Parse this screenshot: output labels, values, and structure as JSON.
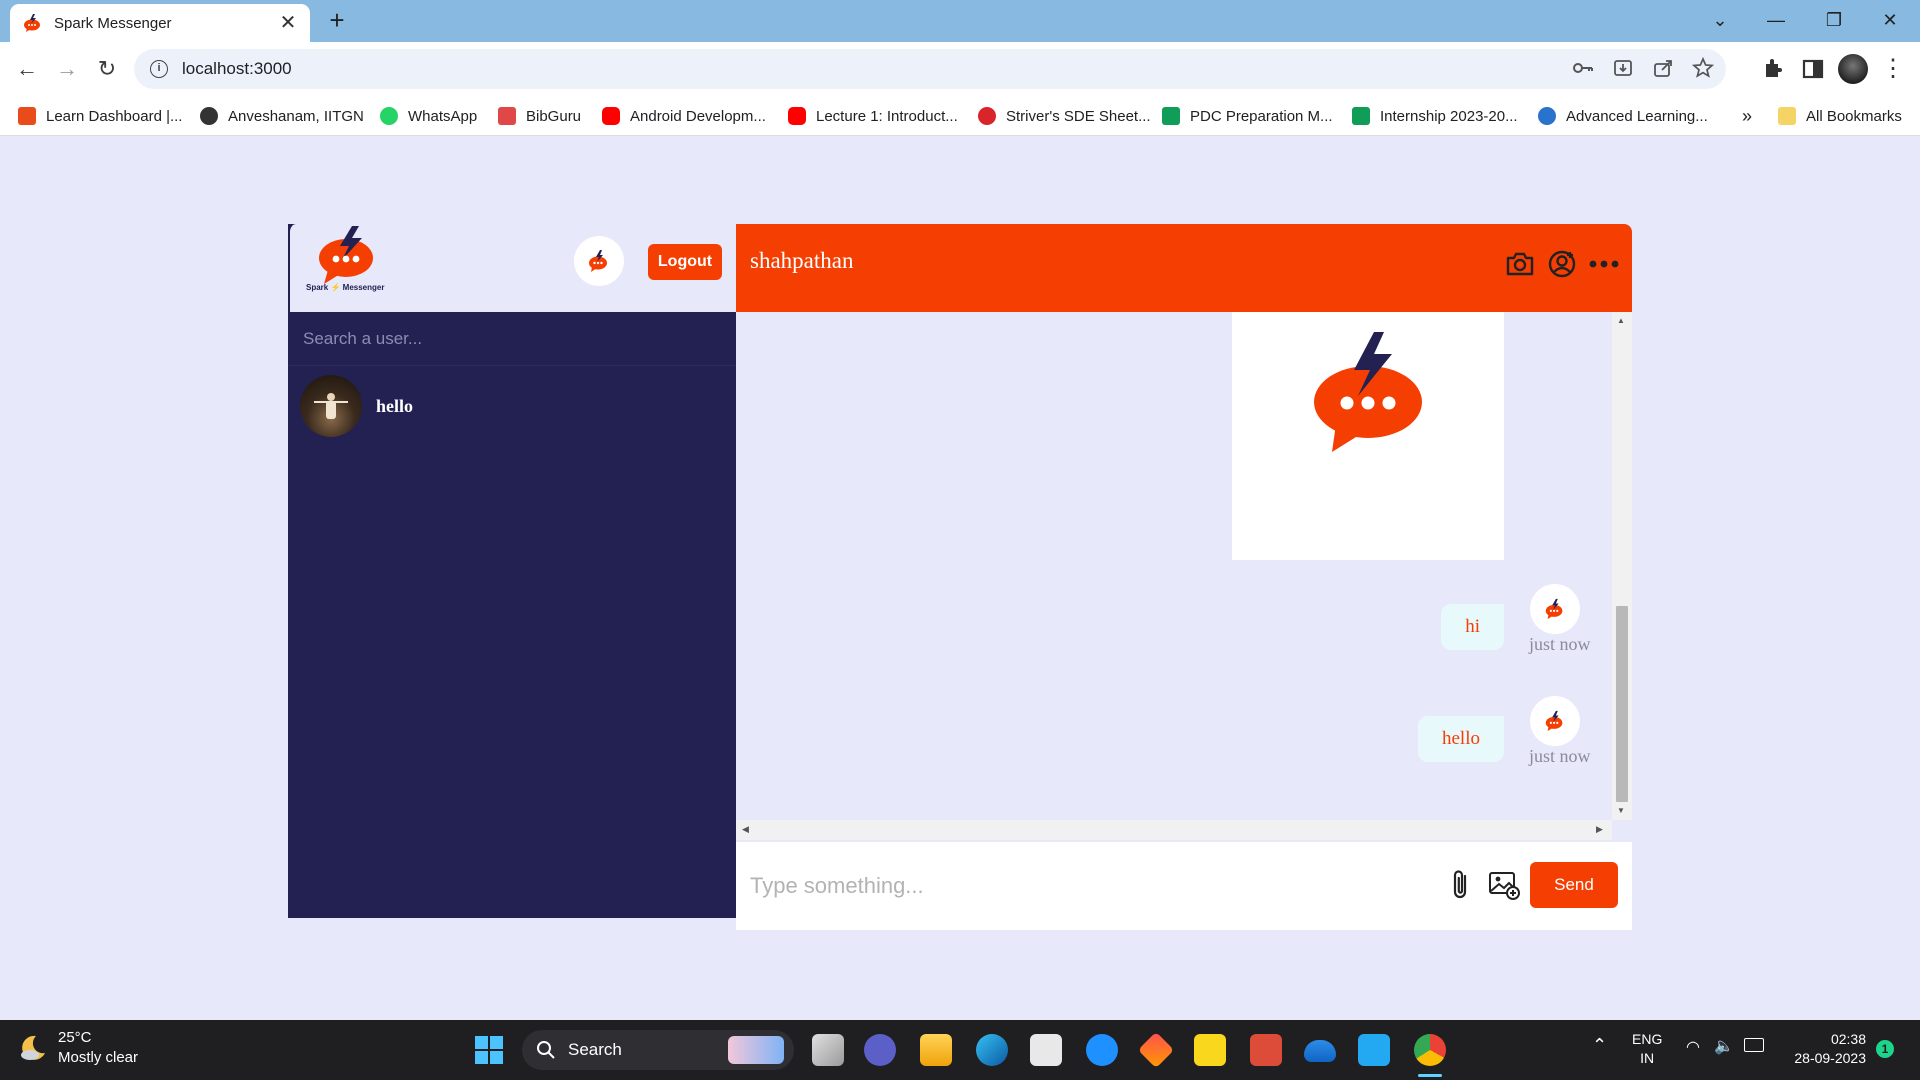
{
  "browser": {
    "tab_title": "Spark Messenger",
    "url": "localhost:3000",
    "bookmarks": [
      {
        "label": "Learn Dashboard |...",
        "icon": "cc-icon",
        "color": "#e94b1a"
      },
      {
        "label": "Anveshanam, IITGN",
        "icon": "globe-icon",
        "color": "#333333"
      },
      {
        "label": "WhatsApp",
        "icon": "whatsapp-icon",
        "color": "#25d366"
      },
      {
        "label": "BibGuru",
        "icon": "bibguru-icon",
        "color": "#e04848"
      },
      {
        "label": "Android Developm...",
        "icon": "youtube-icon",
        "color": "#ff0000"
      },
      {
        "label": "Lecture 1: Introduct...",
        "icon": "youtube-icon",
        "color": "#ff0000"
      },
      {
        "label": "Striver's SDE Sheet...",
        "icon": "tuf-icon",
        "color": "#d9242a"
      },
      {
        "label": "PDC Preparation M...",
        "icon": "sheets-icon",
        "color": "#0f9d58"
      },
      {
        "label": "Internship 2023-20...",
        "icon": "sheets-icon",
        "color": "#0f9d58"
      },
      {
        "label": "Advanced Learning...",
        "icon": "coursera-icon",
        "color": "#2a73cc"
      }
    ],
    "bookmarks_overflow": "»",
    "all_bookmarks": "All Bookmarks"
  },
  "app": {
    "brand_name": "Spark",
    "brand_suffix": "Messenger",
    "logout_label": "Logout",
    "search_placeholder": "Search a user...",
    "users": [
      {
        "name": "hello"
      }
    ],
    "chat_title": "shahpathan",
    "messages": [
      {
        "text": "hi",
        "time": "just now"
      },
      {
        "text": "hello",
        "time": "just now"
      }
    ],
    "input_placeholder": "Type something...",
    "send_label": "Send",
    "colors": {
      "accent": "#f53e02",
      "sidebar": "#222152",
      "background": "#e8e8fb"
    }
  },
  "taskbar": {
    "temperature": "25°C",
    "weather": "Mostly clear",
    "search_label": "Search",
    "lang": "ENG",
    "region": "IN",
    "time": "02:38",
    "date": "28-09-2023",
    "notifications": "1"
  }
}
